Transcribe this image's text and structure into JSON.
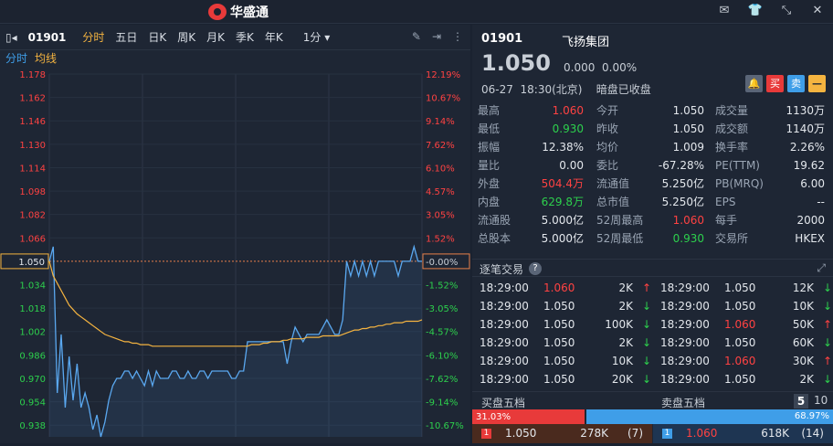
{
  "app": {
    "title": "华盛通"
  },
  "toolbar": {
    "code": "01901",
    "tabs": [
      "分时",
      "五日",
      "日K",
      "周K",
      "月K",
      "季K",
      "年K"
    ],
    "interval": "1分"
  },
  "subtabs": {
    "intraday": "分时",
    "avg": "均线"
  },
  "chart_data": {
    "type": "line",
    "ylim": [
      0.93,
      1.178
    ],
    "ref_price": 1.05,
    "current_label": "1.050",
    "y_ticks": [
      "1.178",
      "1.162",
      "1.146",
      "1.130",
      "1.114",
      "1.098",
      "1.082",
      "1.066",
      "1.050",
      "1.034",
      "1.018",
      "1.002",
      "0.986",
      "0.970",
      "0.954",
      "0.938"
    ],
    "pct_ticks": [
      "12.19%",
      "10.67%",
      "9.14%",
      "7.62%",
      "6.10%",
      "4.57%",
      "3.05%",
      "1.52%",
      "-0.00%",
      "-1.52%",
      "-3.05%",
      "-4.57%",
      "-6.10%",
      "-7.62%",
      "-9.14%",
      "-10.67%"
    ],
    "series": [
      {
        "values": [
          1.05,
          1.06,
          0.96,
          1.0,
          0.95,
          0.985,
          0.955,
          0.98,
          0.95,
          0.96,
          0.95,
          0.935,
          0.945,
          0.93,
          0.94,
          0.955,
          0.965,
          0.97,
          0.97,
          0.975,
          0.975,
          0.97,
          0.975,
          0.97,
          0.965,
          0.975,
          0.965,
          0.975,
          0.97,
          0.97,
          0.97,
          0.975,
          0.975,
          0.97,
          0.97,
          0.975,
          0.97,
          0.97,
          0.975,
          0.975,
          0.97,
          0.975,
          0.975,
          0.975,
          0.975,
          0.975,
          0.97,
          0.97,
          0.975,
          0.975,
          0.995,
          0.995,
          0.995,
          0.995,
          0.995,
          0.995,
          0.995,
          0.995,
          0.995,
          0.995,
          0.98,
          0.995,
          1.005,
          1.0,
          0.995,
          1.0,
          1.0,
          1.0,
          1.0,
          1.005,
          1.01,
          1.005,
          1.0,
          1.0,
          1.01,
          1.05,
          1.04,
          1.05,
          1.04,
          1.05,
          1.04,
          1.05,
          1.04,
          1.05,
          1.05,
          1.05,
          1.05,
          1.05,
          1.04,
          1.05,
          1.05,
          1.05,
          1.06,
          1.05,
          1.05
        ]
      },
      {
        "values": [
          1.05,
          1.04,
          1.035,
          1.03,
          1.025,
          1.02,
          1.017,
          1.014,
          1.012,
          1.01,
          1.008,
          1.006,
          1.004,
          1.002,
          1.0,
          0.999,
          0.998,
          0.997,
          0.996,
          0.995,
          0.995,
          0.994,
          0.994,
          0.993,
          0.993,
          0.993,
          0.992,
          0.992,
          0.992,
          0.992,
          0.992,
          0.992,
          0.992,
          0.992,
          0.992,
          0.992,
          0.992,
          0.992,
          0.992,
          0.992,
          0.992,
          0.992,
          0.992,
          0.992,
          0.992,
          0.992,
          0.992,
          0.992,
          0.992,
          0.992,
          0.992,
          0.993,
          0.993,
          0.993,
          0.994,
          0.994,
          0.995,
          0.995,
          0.995,
          0.996,
          0.996,
          0.997,
          0.997,
          0.997,
          0.997,
          0.998,
          0.998,
          0.998,
          0.998,
          0.999,
          0.999,
          0.999,
          0.999,
          0.999,
          1.0,
          1.001,
          1.002,
          1.003,
          1.003,
          1.004,
          1.004,
          1.005,
          1.005,
          1.006,
          1.006,
          1.007,
          1.007,
          1.008,
          1.008,
          1.008,
          1.009,
          1.009,
          1.009,
          1.009,
          1.01
        ]
      }
    ]
  },
  "quote": {
    "code": "01901",
    "name": "飞扬集团",
    "price": "1.050",
    "chg": "0.000",
    "pct": "0.00%",
    "date": "06-27",
    "time": "18:30(北京)",
    "status": "暗盘已收盘"
  },
  "stats": [
    [
      "最高",
      "1.060",
      "今开",
      "1.050",
      "成交量",
      "1130万"
    ],
    [
      "最低",
      "0.930",
      "昨收",
      "1.050",
      "成交额",
      "1140万"
    ],
    [
      "振幅",
      "12.38%",
      "均价",
      "1.009",
      "换手率",
      "2.26%"
    ],
    [
      "量比",
      "0.00",
      "委比",
      "-67.28%",
      "PE(TTM)",
      "19.62"
    ],
    [
      "外盘",
      "504.4万",
      "流通值",
      "5.250亿",
      "PB(MRQ)",
      "6.00"
    ],
    [
      "内盘",
      "629.8万",
      "总市值",
      "5.250亿",
      "EPS",
      "--"
    ],
    [
      "流通股",
      "5.000亿",
      "52周最高",
      "1.060",
      "每手",
      "2000"
    ],
    [
      "总股本",
      "5.000亿",
      "52周最低",
      "0.930",
      "交易所",
      "HKEX"
    ]
  ],
  "ticks": {
    "title": "逐笔交易",
    "left": [
      [
        "18:29:00",
        "1.060",
        "2K"
      ],
      [
        "18:29:00",
        "1.050",
        "2K"
      ],
      [
        "18:29:00",
        "1.050",
        "100K"
      ],
      [
        "18:29:00",
        "1.050",
        "2K"
      ],
      [
        "18:29:00",
        "1.050",
        "10K"
      ],
      [
        "18:29:00",
        "1.050",
        "20K"
      ]
    ],
    "right": [
      [
        "18:29:00",
        "1.050",
        "12K"
      ],
      [
        "18:29:00",
        "1.050",
        "10K"
      ],
      [
        "18:29:00",
        "1.060",
        "50K"
      ],
      [
        "18:29:00",
        "1.050",
        "60K"
      ],
      [
        "18:29:00",
        "1.060",
        "30K"
      ],
      [
        "18:29:00",
        "1.050",
        "2K"
      ]
    ]
  },
  "book": {
    "buy_title": "买盘五档",
    "sell_title": "卖盘五档",
    "levels5": "5",
    "levels10": "10",
    "buy_pct": "31.03%",
    "sell_pct": "68.97%",
    "buy_ratio": 0.3103,
    "buy": {
      "lvl": "1",
      "price": "1.050",
      "vol": "278K",
      "cnt": "(7)"
    },
    "sell": {
      "lvl": "1",
      "price": "1.060",
      "vol": "618K",
      "cnt": "(14)"
    }
  }
}
